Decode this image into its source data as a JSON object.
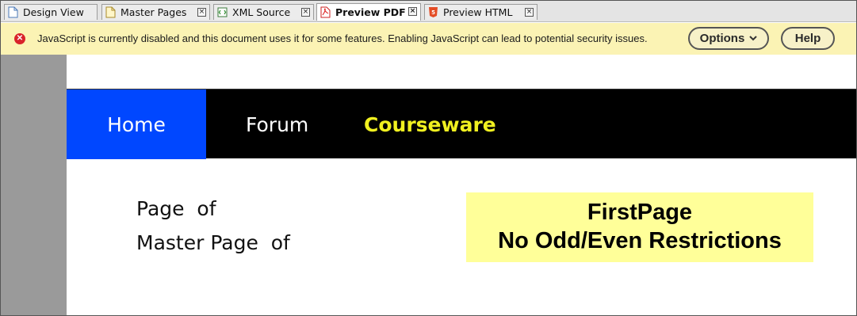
{
  "tabs": [
    {
      "label": "Design View",
      "icon": "page-icon"
    },
    {
      "label": "Master Pages",
      "icon": "master-page-icon"
    },
    {
      "label": "XML Source",
      "icon": "xml-icon"
    },
    {
      "label": "Preview PDF",
      "icon": "pdf-icon",
      "active": true
    },
    {
      "label": "Preview HTML",
      "icon": "html5-icon"
    }
  ],
  "notice": {
    "icon": "error-icon",
    "message": "JavaScript is currently disabled and this document uses it for some features. Enabling JavaScript can lead to potential security issues.",
    "options_label": "Options",
    "help_label": "Help"
  },
  "nav": {
    "home": "Home",
    "forum": "Forum",
    "courseware": "Courseware"
  },
  "page_info": {
    "line1": "Page  of",
    "line2": "Master Page  of"
  },
  "master_box": {
    "line1": "FirstPage",
    "line2": "No Odd/Even Restrictions"
  },
  "colors": {
    "nav_home_bg": "#0047ff",
    "nav_bg": "#000000",
    "courseware_text": "#f0f020",
    "notice_bg": "#fbf3b4",
    "master_box_bg": "#ffff99"
  }
}
